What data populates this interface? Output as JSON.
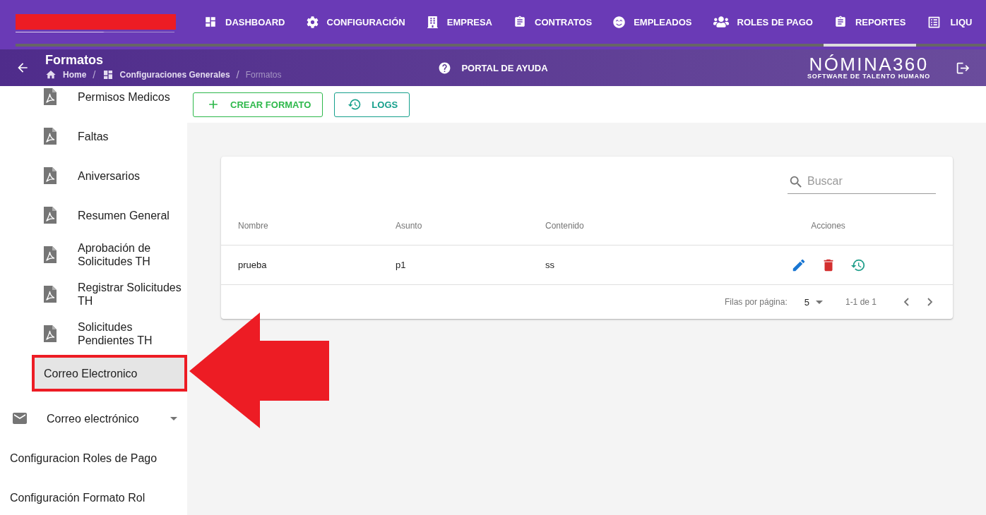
{
  "nav": {
    "tabs": [
      {
        "label": "DASHBOARD",
        "selected": false
      },
      {
        "label": "CONFIGURACIÓN",
        "selected": false
      },
      {
        "label": "EMPRESA",
        "selected": false
      },
      {
        "label": "CONTRATOS",
        "selected": false
      },
      {
        "label": "EMPLEADOS",
        "selected": false
      },
      {
        "label": "ROLES DE PAGO",
        "selected": false
      },
      {
        "label": "REPORTES",
        "selected": true
      },
      {
        "label": "LIQU",
        "selected": false
      }
    ]
  },
  "page_bar": {
    "title": "Formatos",
    "breadcrumbs": [
      {
        "label": "Home",
        "current": false
      },
      {
        "separator": "/",
        "label": "Configuraciones Generales",
        "current": false
      },
      {
        "separator": "/",
        "label": "Formatos",
        "current": true
      }
    ],
    "help_link": "PORTAL DE AYUDA",
    "brand": {
      "name": "NÓMINA360",
      "tagline": "SOFTWARE DE TALENTO HUMANO"
    }
  },
  "sidebar": {
    "items": [
      {
        "kind": "report",
        "label": "Permisos Medicos",
        "selected": false,
        "highlighted": false
      },
      {
        "kind": "report",
        "label": "Faltas",
        "selected": false,
        "highlighted": false
      },
      {
        "kind": "report",
        "label": "Aniversarios",
        "selected": false,
        "highlighted": false
      },
      {
        "kind": "report",
        "label": "Resumen General",
        "selected": false,
        "highlighted": false
      },
      {
        "kind": "report",
        "label": "Aprobación de Solicitudes TH",
        "selected": false,
        "highlighted": false
      },
      {
        "kind": "report",
        "label": "Registrar Solicitudes TH",
        "selected": false,
        "highlighted": false
      },
      {
        "kind": "report",
        "label": "Solicitudes Pendientes TH",
        "selected": false,
        "highlighted": false
      },
      {
        "kind": "sub",
        "label": "Correo Electronico",
        "selected": true,
        "highlighted": true
      },
      {
        "kind": "group",
        "label": "Correo electrónico",
        "selected": false,
        "highlighted": false,
        "expanded": false
      },
      {
        "kind": "link",
        "label": "Configuracion Roles de Pago",
        "selected": false,
        "highlighted": false
      },
      {
        "kind": "link",
        "label": "Configuración Formato Rol",
        "selected": false,
        "highlighted": false
      }
    ]
  },
  "toolbar": {
    "buttons": [
      {
        "kind": "create",
        "label": "CREAR FORMATO"
      },
      {
        "kind": "logs",
        "label": "LOGS"
      }
    ]
  },
  "table": {
    "search": {
      "placeholder": "Buscar"
    },
    "columns": [
      "Nombre",
      "Asunto",
      "Contenido",
      "Acciones"
    ],
    "rows": [
      {
        "cells": [
          "prueba",
          "p1",
          "ss"
        ],
        "actions": [
          {
            "kind": "edit"
          },
          {
            "kind": "delete"
          },
          {
            "kind": "history"
          }
        ]
      }
    ],
    "pagination": {
      "rows_per_page_label": "Filas por página:",
      "rows_per_page": "5",
      "range": "1-1 de 1"
    }
  }
}
